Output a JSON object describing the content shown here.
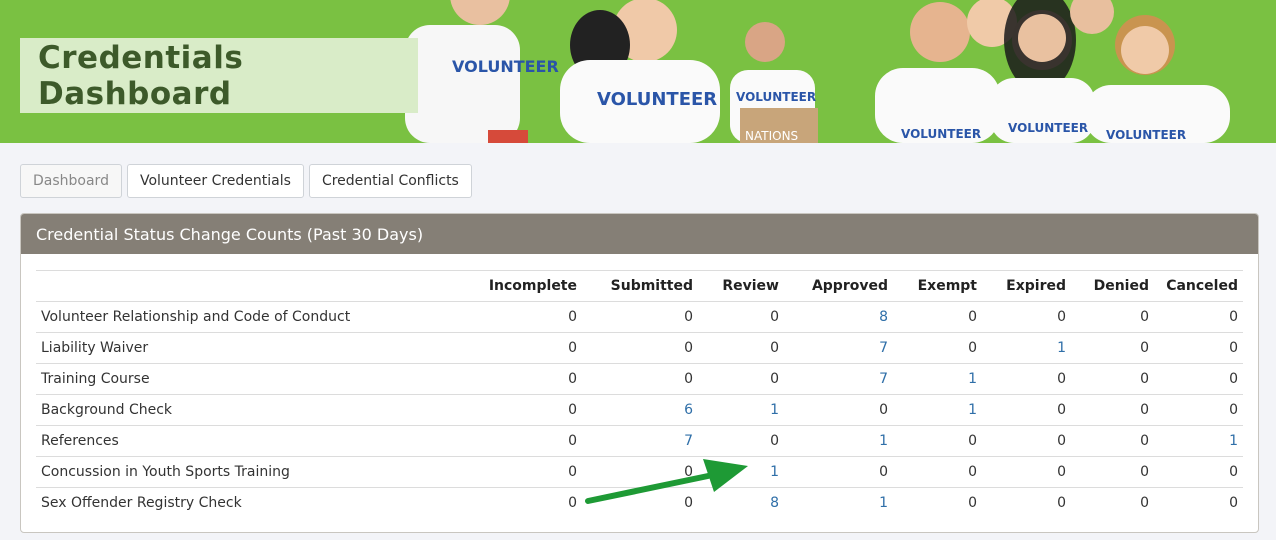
{
  "header": {
    "title": "Credentials Dashboard",
    "shirt_text": "VOLUNTEER",
    "box_text": "NATIONS"
  },
  "tabs": [
    {
      "label": "Dashboard",
      "active": true
    },
    {
      "label": "Volunteer Credentials",
      "active": false
    },
    {
      "label": "Credential Conflicts",
      "active": false
    }
  ],
  "panel": {
    "title": "Credential Status Change Counts (Past 30 Days)",
    "columns": [
      "",
      "Incomplete",
      "Submitted",
      "Review",
      "Approved",
      "Exempt",
      "Expired",
      "Denied",
      "Canceled"
    ],
    "rows": [
      {
        "name": "Volunteer Relationship and Code of Conduct",
        "values": [
          "0",
          "0",
          "0",
          "8",
          "0",
          "0",
          "0",
          "0"
        ]
      },
      {
        "name": "Liability Waiver",
        "values": [
          "0",
          "0",
          "0",
          "7",
          "0",
          "1",
          "0",
          "0"
        ]
      },
      {
        "name": "Training Course",
        "values": [
          "0",
          "0",
          "0",
          "7",
          "1",
          "0",
          "0",
          "0"
        ]
      },
      {
        "name": "Background Check",
        "values": [
          "0",
          "6",
          "1",
          "0",
          "1",
          "0",
          "0",
          "0"
        ]
      },
      {
        "name": "References",
        "values": [
          "0",
          "7",
          "0",
          "1",
          "0",
          "0",
          "0",
          "1"
        ]
      },
      {
        "name": "Concussion in Youth Sports Training",
        "values": [
          "0",
          "0",
          "1",
          "0",
          "0",
          "0",
          "0",
          "0"
        ]
      },
      {
        "name": "Sex Offender Registry Check",
        "values": [
          "0",
          "0",
          "8",
          "1",
          "0",
          "0",
          "0",
          "0"
        ]
      }
    ]
  },
  "colors": {
    "banner_green": "#7ac142",
    "panel_header": "#857f76",
    "link_blue": "#2f6fa8",
    "arrow_green": "#1e9a35"
  }
}
